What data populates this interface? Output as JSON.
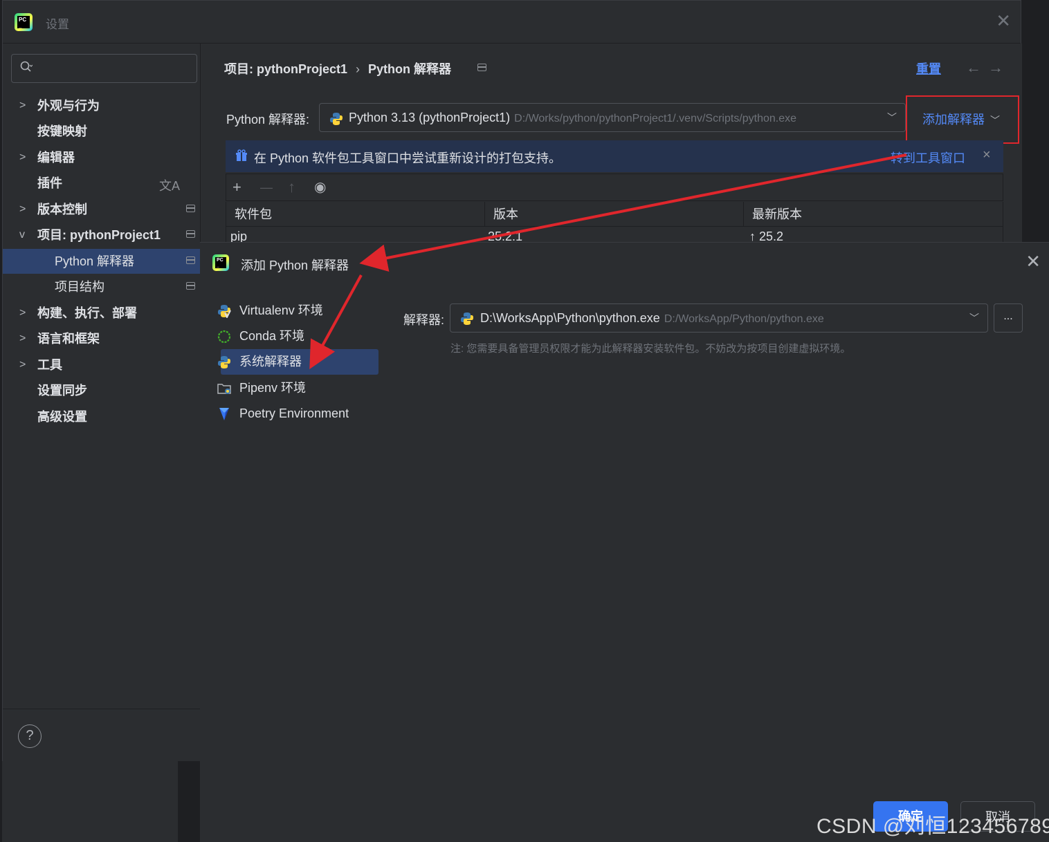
{
  "settings": {
    "title": "设置",
    "search_placeholder": "",
    "nav": [
      {
        "label": "外观与行为",
        "chevron": ">"
      },
      {
        "label": "按键映射",
        "chevron": ""
      },
      {
        "label": "编辑器",
        "chevron": ">"
      },
      {
        "label": "插件",
        "chevron": ""
      },
      {
        "label": "版本控制",
        "chevron": ">"
      },
      {
        "label": "项目: pythonProject1",
        "chevron": "v"
      },
      {
        "label": "Python 解释器",
        "chevron": ""
      },
      {
        "label": "项目结构",
        "chevron": ""
      },
      {
        "label": "构建、执行、部署",
        "chevron": ">"
      },
      {
        "label": "语言和框架",
        "chevron": ">"
      },
      {
        "label": "工具",
        "chevron": ">"
      },
      {
        "label": "设置同步",
        "chevron": ""
      },
      {
        "label": "高级设置",
        "chevron": ""
      }
    ],
    "help_label": "?",
    "breadcrumb": {
      "project": "项目: pythonProject1",
      "separator": "›",
      "page": "Python 解释器"
    },
    "reset_label": "重置",
    "nav_arrows": "←→",
    "interpreter_label": "Python 解释器:",
    "interpreter_name": "Python 3.13 (pythonProject1)",
    "interpreter_path": "D:/Works/python/pythonProject1/.venv/Scripts/python.exe",
    "add_interpreter_label": "添加解释器",
    "banner": {
      "message": "在 Python 软件包工具窗口中尝试重新设计的打包支持。",
      "link": "转到工具窗口",
      "close": "×"
    },
    "toolbar_icons": {
      "add": "+",
      "remove": "—",
      "upgrade": "↑",
      "show": "◉"
    },
    "table": {
      "columns": [
        "软件包",
        "版本",
        "最新版本"
      ],
      "rows": [
        {
          "package": "pip",
          "version": "25.2.1",
          "latest": "↑ 25.2"
        }
      ]
    }
  },
  "dialog": {
    "title": "添加 Python 解释器",
    "env_types": [
      {
        "label": "Virtualenv 环境",
        "icon": "virtualenv-icon"
      },
      {
        "label": "Conda 环境",
        "icon": "conda-icon"
      },
      {
        "label": "系统解释器",
        "icon": "python-icon"
      },
      {
        "label": "Pipenv 环境",
        "icon": "pipenv-icon"
      },
      {
        "label": "Poetry Environment",
        "icon": "poetry-icon"
      }
    ],
    "interpreter_label": "解释器:",
    "interpreter_name": "D:\\WorksApp\\Python\\python.exe",
    "interpreter_path": "D:/WorksApp/Python/python.exe",
    "browse_label": "...",
    "note": "注: 您需要具备管理员权限才能为此解释器安装软件包。不妨改为按项目创建虚拟环境。",
    "ok_label": "确定",
    "cancel_label": "取消"
  },
  "watermark": "CSDN @刘恒123456789",
  "colors": {
    "accent": "#3574f0",
    "link": "#548af7",
    "selection": "#2e436e",
    "annotation": "#e0262c"
  }
}
